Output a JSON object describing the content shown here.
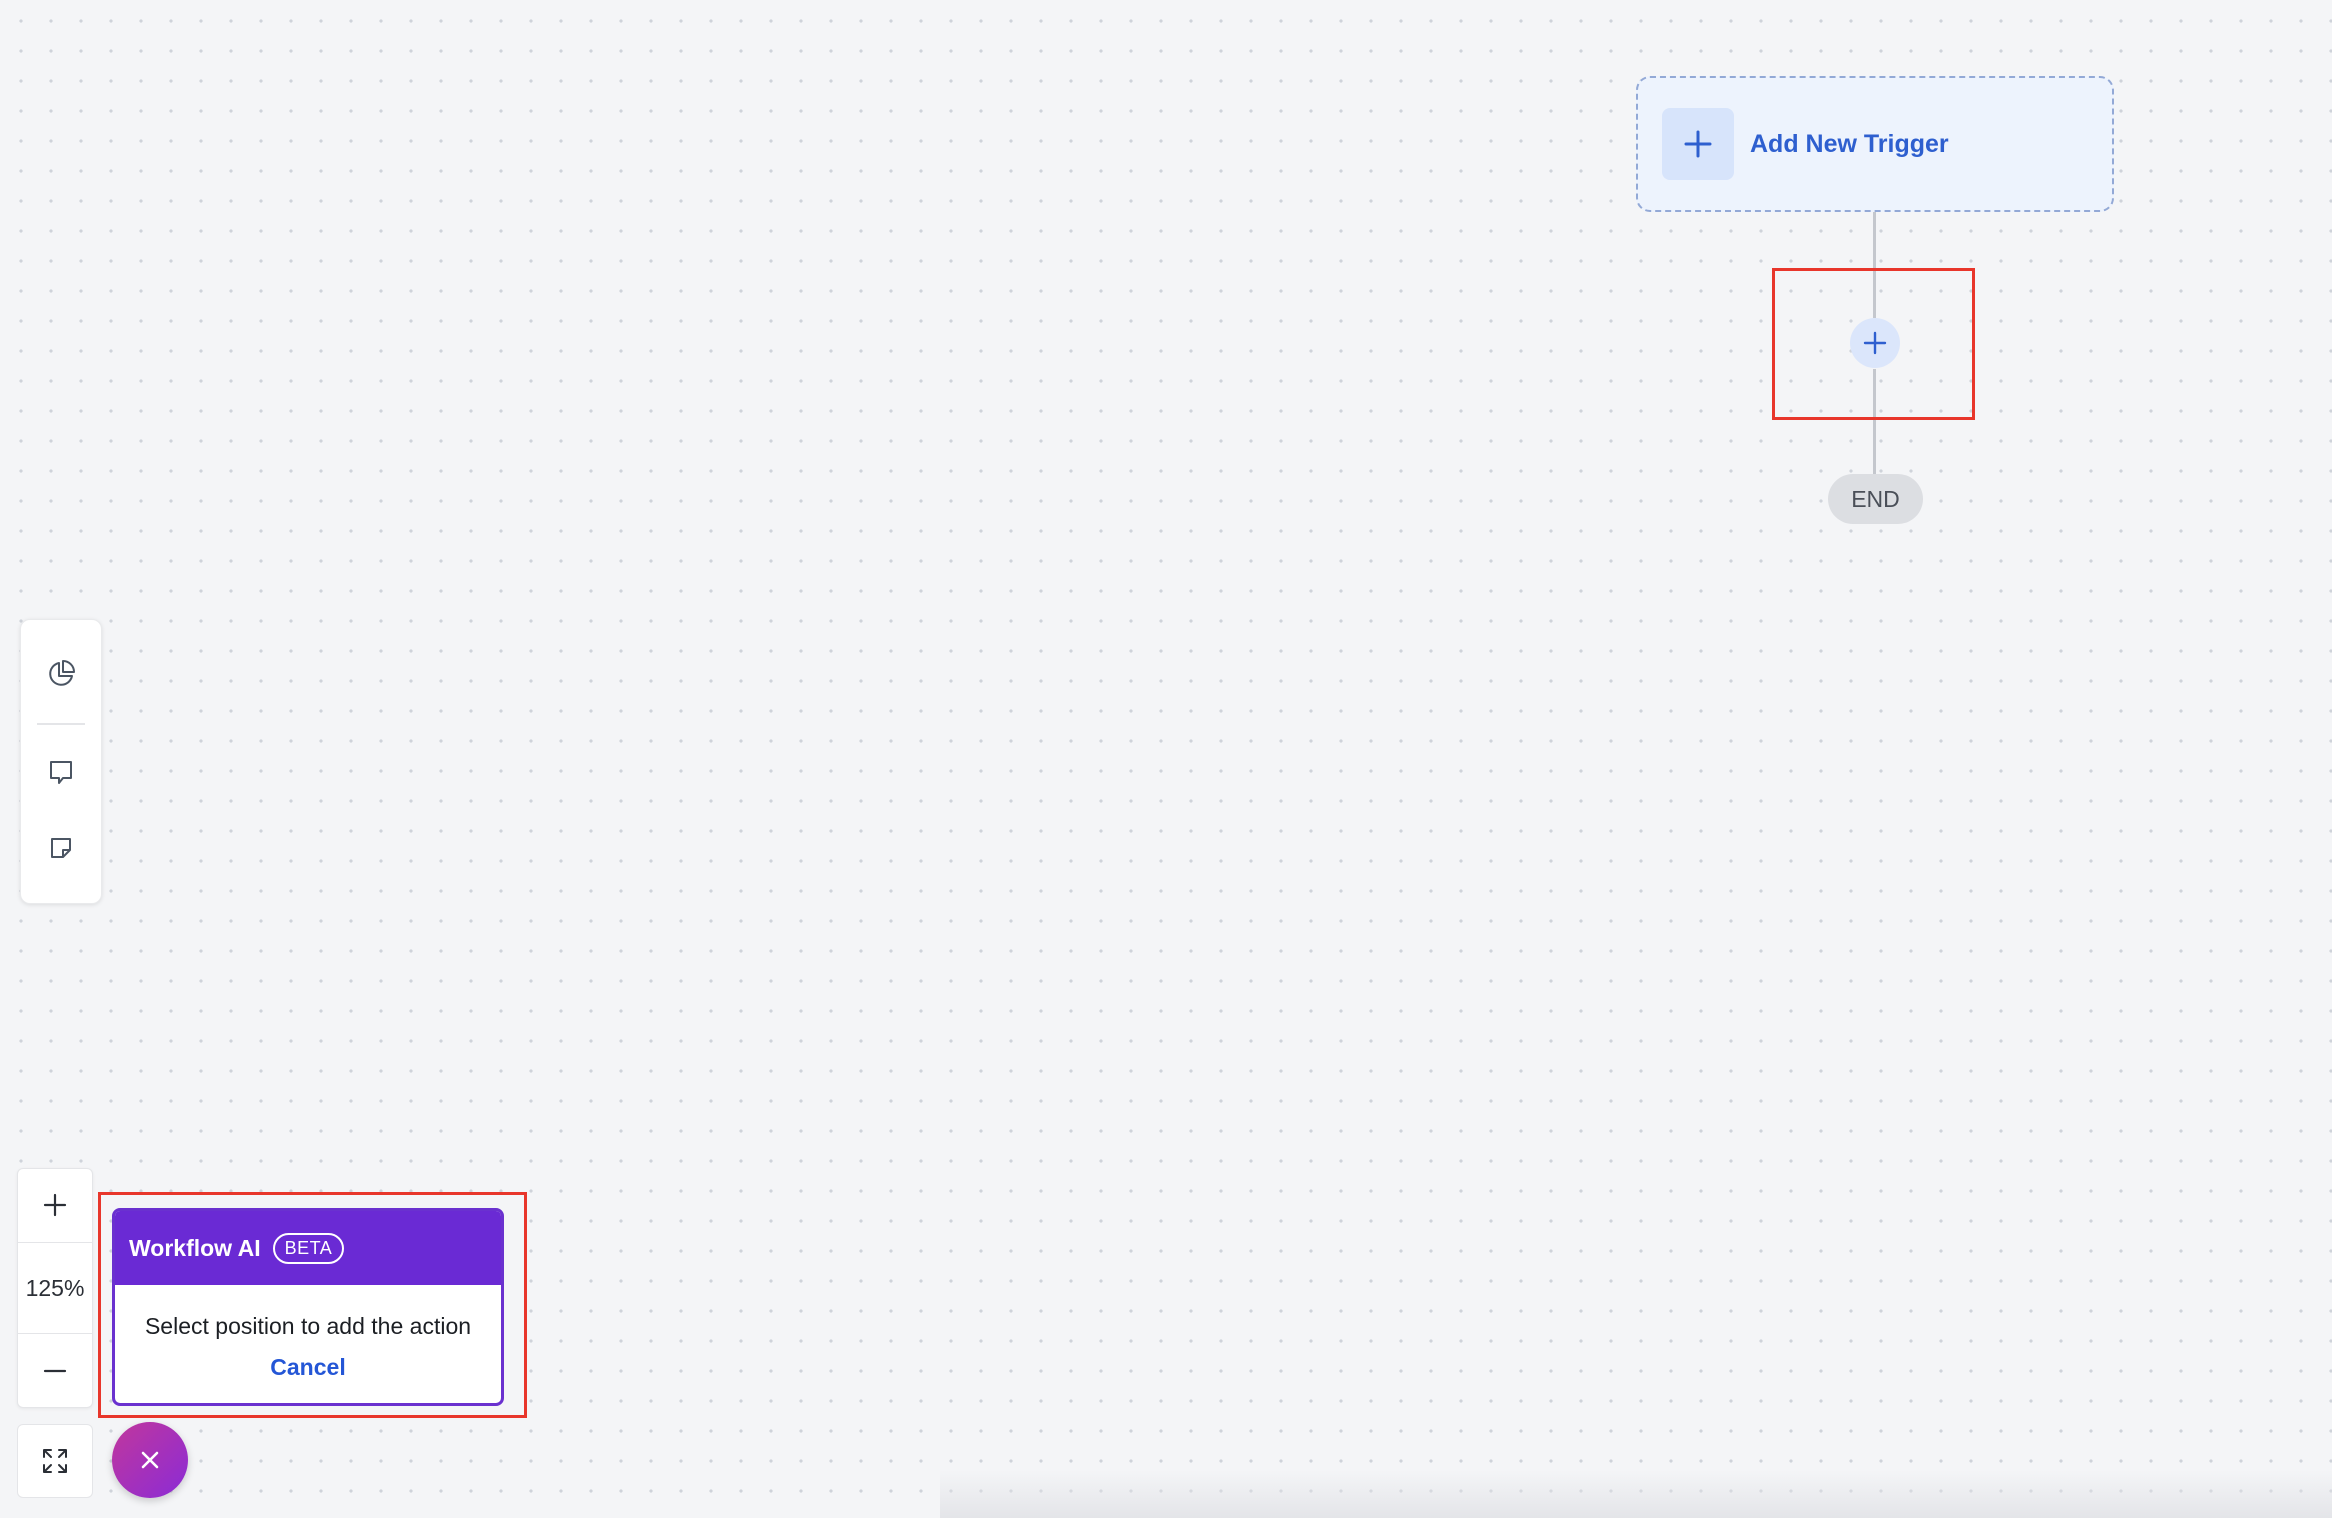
{
  "canvas": {
    "trigger_card": {
      "label": "Add New Trigger"
    },
    "end_node": {
      "label": "END"
    }
  },
  "zoom": {
    "level": "125%"
  },
  "workflow_ai": {
    "title": "Workflow AI",
    "badge": "BETA",
    "message": "Select position to add the action",
    "cancel_label": "Cancel"
  },
  "icons": {
    "trigger_add": "plus-icon",
    "add_step": "plus-icon",
    "left_toolbar": [
      "pie-chart-icon",
      "comment-icon",
      "sticky-note-icon"
    ],
    "zoom_in": "plus-icon",
    "zoom_out": "minus-icon",
    "fit_view": "expand-icon",
    "close_fab": "close-icon"
  },
  "colors": {
    "accent_blue": "#2e5fcf",
    "ai_purple": "#6a2ad4",
    "highlight_red": "#e8362b"
  }
}
